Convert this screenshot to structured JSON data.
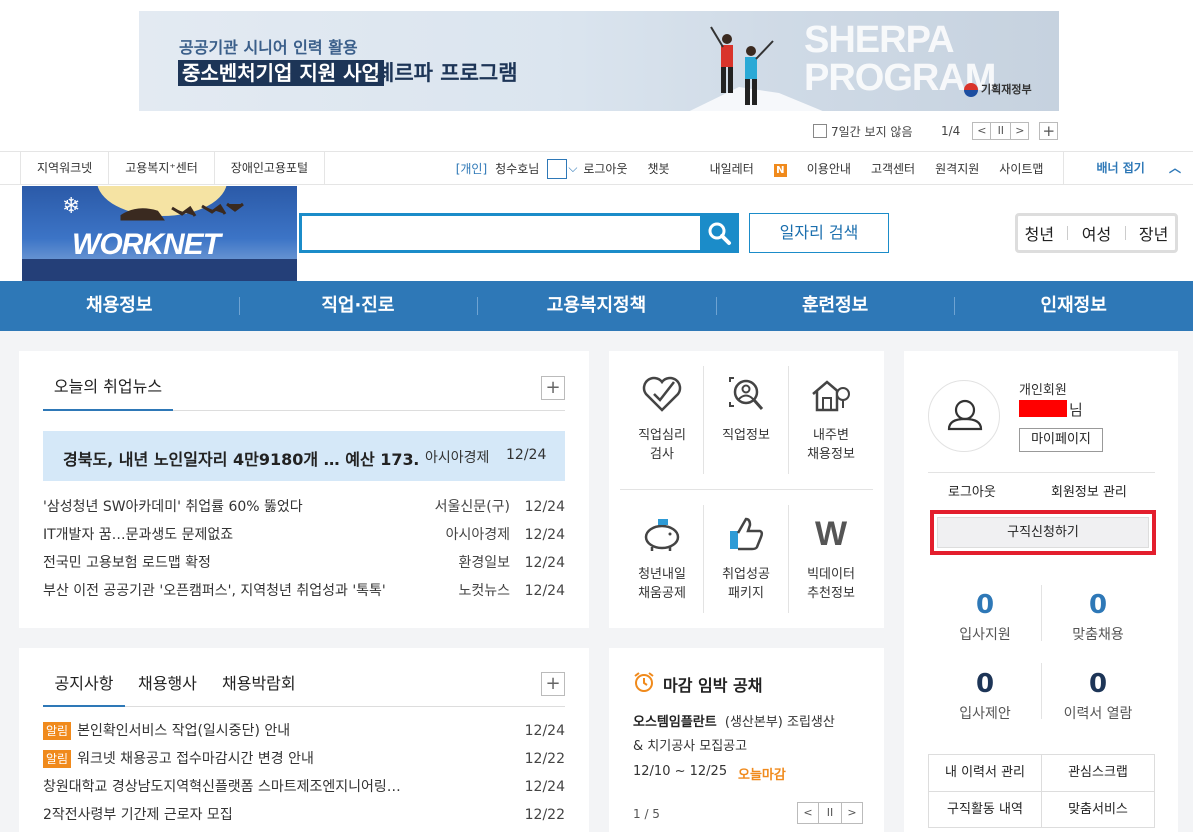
{
  "banner": {
    "line1": "공공기관 시니어 인력 활용",
    "line2_highlight": "중소벤처기업 지원 사업",
    "line2_title": "셰르파 프로그램",
    "sherpa_line1": "SHERPA",
    "sherpa_line2": "PROGRAM",
    "gov": "기획재정부",
    "hide_7days": "7일간 보지 않음",
    "page": "1/4",
    "prev": "<",
    "pause": "II",
    "next": ">",
    "add": "+"
  },
  "util_left": [
    "지역워크넷",
    "고용복지⁺센터",
    "장애인고용포털"
  ],
  "util_right": {
    "personal_tag": "[개인]",
    "user": "청수호님",
    "logout": "로그아웃",
    "chatbot": "챗봇",
    "letter": "내일레터",
    "letter_badge": "N",
    "guide": "이용안내",
    "center": "고객센터",
    "remote": "원격지원",
    "sitemap": "사이트맵",
    "banner_fold": "배너 접기"
  },
  "logo": {
    "text": "WORKNET"
  },
  "search": {
    "placeholder": "",
    "job_search": "일자리 검색"
  },
  "targets": [
    "청년",
    "여성",
    "장년"
  ],
  "gnb": [
    "채용정보",
    "직업·진로",
    "고용복지정책",
    "훈련정보",
    "인재정보"
  ],
  "news": {
    "tab": "오늘의 취업뉴스",
    "featured": {
      "title": "경북도, 내년 노인일자리 4만9180개 … 예산 173…",
      "source": "아시아경제",
      "date": "12/24"
    },
    "items": [
      {
        "title": "'삼성청년 SW아카데미' 취업률 60% 뚫었다",
        "source": "서울신문(구)",
        "date": "12/24"
      },
      {
        "title": "IT개발자 꿈…문과생도 문제없죠",
        "source": "아시아경제",
        "date": "12/24"
      },
      {
        "title": "전국민 고용보험 로드맵 확정",
        "source": "환경일보",
        "date": "12/24"
      },
      {
        "title": "부산 이전 공공기관 '오픈캠퍼스', 지역청년 취업성과 '톡톡'",
        "source": "노컷뉴스",
        "date": "12/24"
      }
    ]
  },
  "services": [
    {
      "line1": "직업심리",
      "line2": "검사"
    },
    {
      "line1": "직업정보",
      "line2": ""
    },
    {
      "line1": "내주변",
      "line2": "채용정보"
    },
    {
      "line1": "청년내일",
      "line2": "채움공제"
    },
    {
      "line1": "취업성공",
      "line2": "패키지"
    },
    {
      "line1": "빅데이터",
      "line2": "추천정보"
    }
  ],
  "member": {
    "type": "개인회원",
    "name_suffix": "님",
    "mypage": "마이페이지",
    "logout": "로그아웃",
    "edit": "회원정보 관리",
    "apply": "구직신청하기",
    "stats": [
      {
        "value": "0",
        "label": "입사지원"
      },
      {
        "value": "0",
        "label": "맞춤채용"
      },
      {
        "value": "0",
        "label": "입사제안"
      },
      {
        "value": "0",
        "label": "이력서 열람"
      }
    ],
    "links": [
      "내 이력서 관리",
      "관심스크랩",
      "구직활동 내역",
      "맞춤서비스"
    ]
  },
  "notice": {
    "tabs": [
      "공지사항",
      "채용행사",
      "채용박람회"
    ],
    "items": [
      {
        "tag": "알림",
        "title": "본인확인서비스 작업(일시중단) 안내",
        "date": "12/24"
      },
      {
        "tag": "알림",
        "title": "워크넷 채용공고 접수마감시간 변경 안내",
        "date": "12/22"
      },
      {
        "tag": "",
        "title": "창원대학교 경상남도지역혁신플랫폼 스마트제조엔지니어링…",
        "date": "12/24"
      },
      {
        "tag": "",
        "title": "2작전사령부 기간제 근로자 모집",
        "date": "12/22"
      }
    ]
  },
  "deadline": {
    "title": "마감 임박 공채",
    "company": "오스템임플란트",
    "dept": "(생산본부)",
    "job_line1": "조립생산",
    "job_line2": "& 치기공사 모집공고",
    "period": "12/10 ~ 12/25",
    "status": "오늘마감",
    "page": "1 / 5",
    "prev": "<",
    "pause": "II",
    "next": ">"
  },
  "colors": {
    "accent": "#2e78b7",
    "search": "#1b8cc9",
    "orange": "#f08a1c",
    "highlight": "#e31e2d"
  }
}
